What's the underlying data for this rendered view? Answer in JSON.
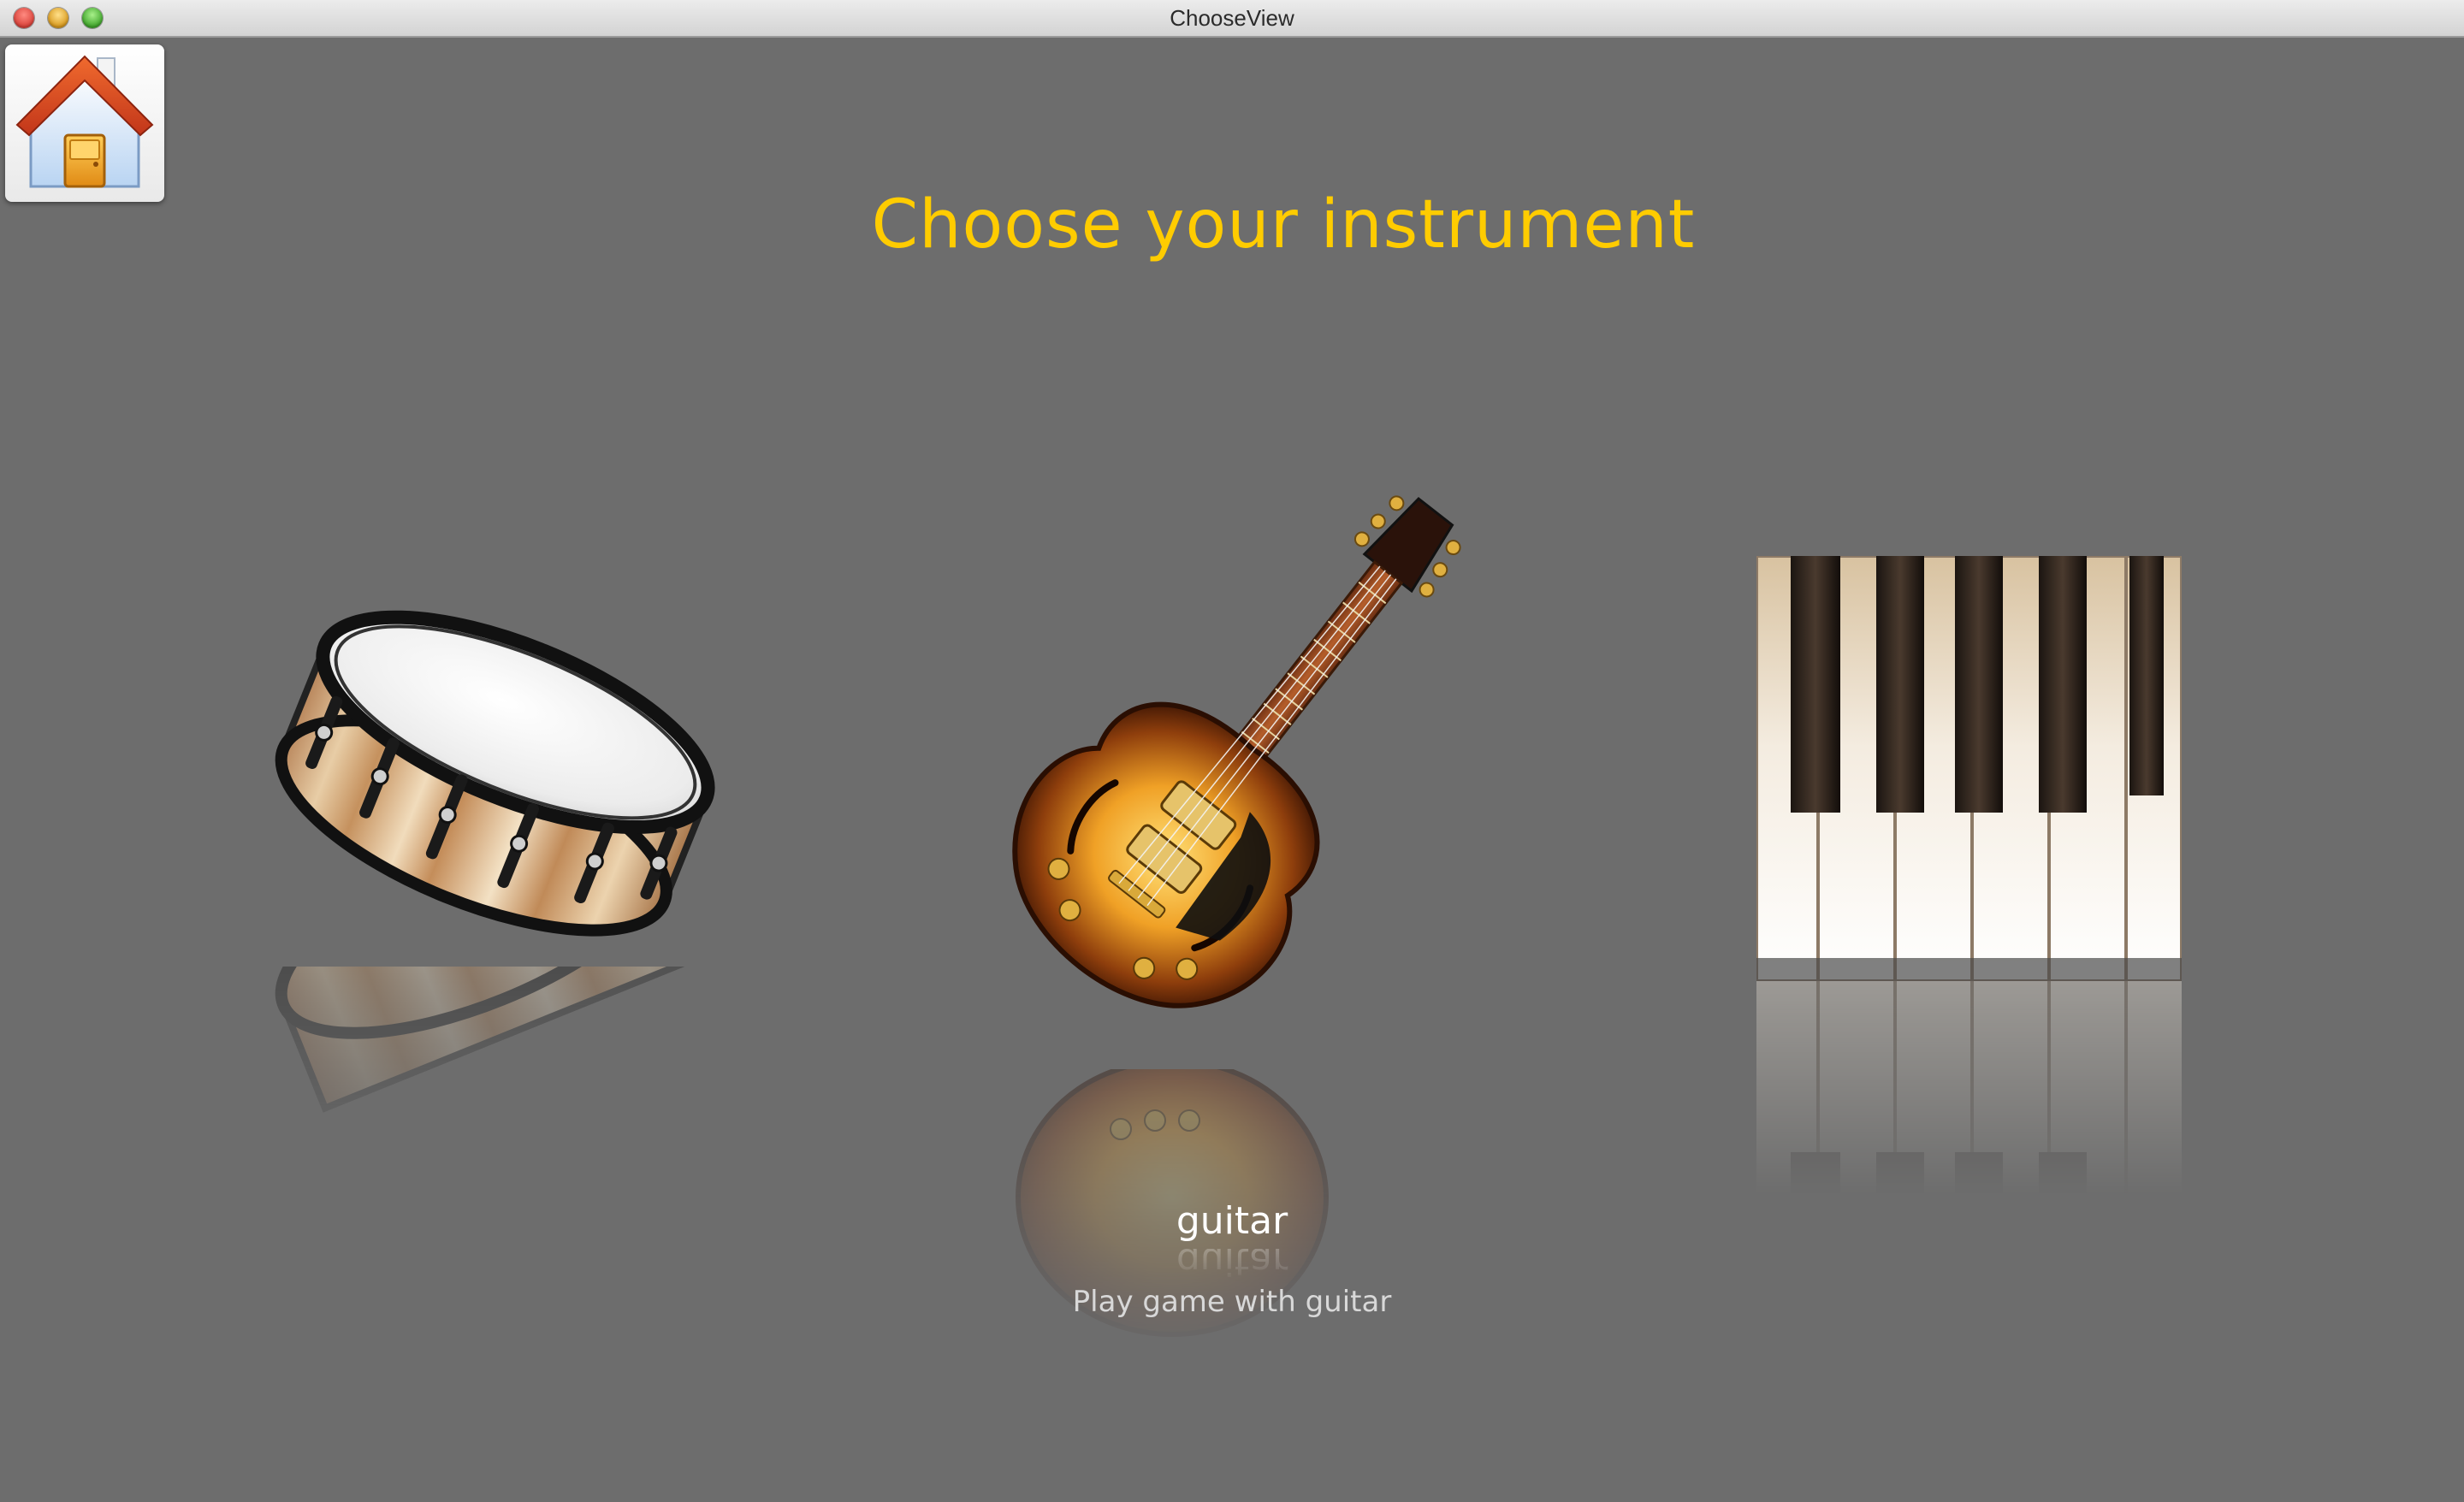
{
  "window": {
    "title": "ChooseView"
  },
  "home": {
    "icon": "house-icon"
  },
  "heading": "Choose your instrument",
  "instruments": [
    {
      "name": "drum",
      "icon": "snare-drum-icon"
    },
    {
      "name": "guitar",
      "icon": "electric-guitar-icon"
    },
    {
      "name": "piano",
      "icon": "piano-keys-icon"
    }
  ],
  "selected": {
    "title": "guitar",
    "subtitle": "Play game with guitar"
  },
  "colors": {
    "background": "#6d6d6d",
    "heading": "#ffcc00",
    "caption": "#ffffff"
  }
}
